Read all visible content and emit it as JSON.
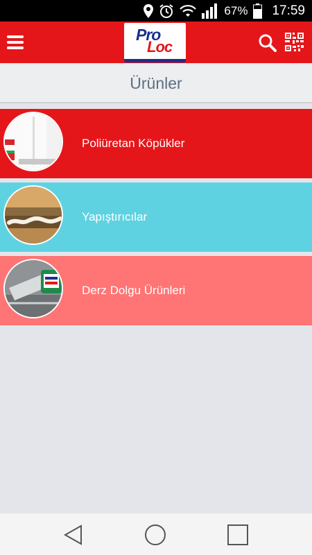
{
  "status_bar": {
    "battery_percent": "67%",
    "time": "17:59",
    "icons": [
      "location-icon",
      "alarm-icon",
      "wifi-icon",
      "signal-icon",
      "battery-icon"
    ]
  },
  "app_bar": {
    "menu_icon": "menu-icon",
    "logo_line1": "Pro",
    "logo_line2": "Loc",
    "search_icon": "search-icon",
    "qr_icon": "qr-code-icon",
    "colors": {
      "brand_red": "#e5161a",
      "brand_blue": "#1b2f8c"
    }
  },
  "page": {
    "title": "Ürünler"
  },
  "products": [
    {
      "label": "Poliüretan Köpükler",
      "color": "#e5161a"
    },
    {
      "label": "Yapıştırıcılar",
      "color": "#5fd2e1"
    },
    {
      "label": "Derz Dolgu Ürünleri",
      "color": "#ff7474"
    }
  ],
  "nav_bar": {
    "icons": [
      "back-icon",
      "home-icon",
      "recents-icon"
    ]
  }
}
